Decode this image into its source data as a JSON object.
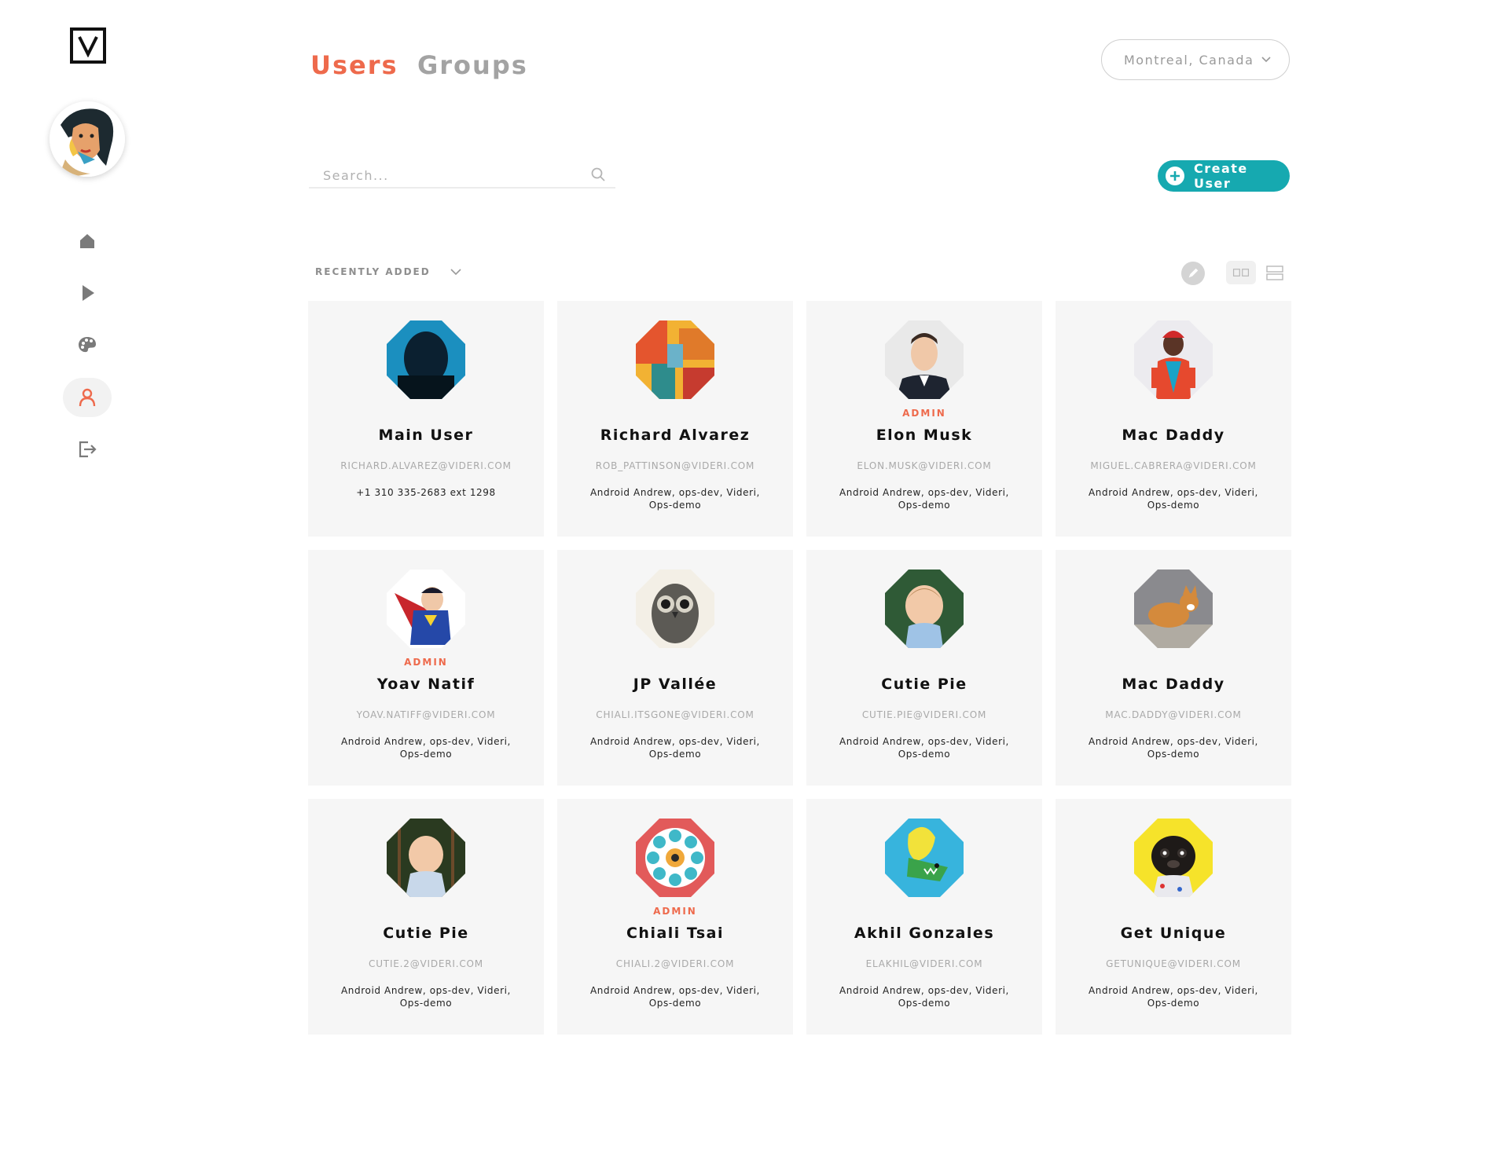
{
  "app": {
    "logo_letter": "V",
    "accent_color": "#ee6a4c",
    "primary_button_color": "#16a9b0"
  },
  "sidebar": {
    "items": [
      {
        "icon": "home-icon",
        "active": false
      },
      {
        "icon": "play-icon",
        "active": false
      },
      {
        "icon": "palette-icon",
        "active": false
      },
      {
        "icon": "user-icon",
        "active": true
      },
      {
        "icon": "logout-icon",
        "active": false
      }
    ]
  },
  "header": {
    "tabs": [
      {
        "label": "Users",
        "active": true
      },
      {
        "label": "Groups",
        "active": false
      }
    ],
    "location": "Montreal, Canada"
  },
  "search": {
    "placeholder": "Search..."
  },
  "create_button": {
    "label": "Create User"
  },
  "sort": {
    "label": "RECENTLY ADDED"
  },
  "users": [
    {
      "name": "Main User",
      "role": "",
      "email": "RICHARD.ALVAREZ@VIDERI.COM",
      "detail": "+1 310 335-2683 ext 1298",
      "avatar": "dark-silhouette"
    },
    {
      "name": "Richard Alvarez",
      "role": "",
      "email": "ROB_PATTINSON@VIDERI.COM",
      "detail": "Android Andrew, ops-dev, Videri, Ops-demo",
      "avatar": "abstract-painting"
    },
    {
      "name": "Elon Musk",
      "role": "ADMIN",
      "email": "ELON.MUSK@VIDERI.COM",
      "detail": "Android Andrew, ops-dev, Videri, Ops-demo",
      "avatar": "man-in-suit"
    },
    {
      "name": "Mac Daddy",
      "role": "",
      "email": "MIGUEL.CABRERA@VIDERI.COM",
      "detail": "Android Andrew, ops-dev, Videri, Ops-demo",
      "avatar": "colorful-person"
    },
    {
      "name": "Yoav Natif",
      "role": "ADMIN",
      "email": "YOAV.NATIFF@VIDERI.COM",
      "detail": "Android Andrew, ops-dev, Videri, Ops-demo",
      "avatar": "superhero"
    },
    {
      "name": "JP Vallée",
      "role": "",
      "email": "CHIALI.ITSGONE@VIDERI.COM",
      "detail": "Android Andrew, ops-dev, Videri, Ops-demo",
      "avatar": "owl"
    },
    {
      "name": "Cutie Pie",
      "role": "",
      "email": "CUTIE.PIE@VIDERI.COM",
      "detail": "Android Andrew, ops-dev, Videri, Ops-demo",
      "avatar": "baby"
    },
    {
      "name": "Mac Daddy",
      "role": "",
      "email": "MAC.DADDY@VIDERI.COM",
      "detail": "Android Andrew, ops-dev, Videri, Ops-demo",
      "avatar": "corgi"
    },
    {
      "name": "Cutie Pie",
      "role": "",
      "email": "CUTIE.2@VIDERI.COM",
      "detail": "Android Andrew, ops-dev, Videri, Ops-demo",
      "avatar": "baby-swing"
    },
    {
      "name": "Chiali Tsai",
      "role": "ADMIN",
      "email": "CHIALI.2@VIDERI.COM",
      "detail": "Android Andrew, ops-dev, Videri, Ops-demo",
      "avatar": "mandala"
    },
    {
      "name": "Akhil Gonzales",
      "role": "",
      "email": "ELAKHIL@VIDERI.COM",
      "detail": "Android Andrew, ops-dev, Videri, Ops-demo",
      "avatar": "cartoon-dinosaur"
    },
    {
      "name": "Get Unique",
      "role": "",
      "email": "GETUNIQUE@VIDERI.COM",
      "detail": "Android Andrew, ops-dev, Videri, Ops-demo",
      "avatar": "pug"
    }
  ]
}
